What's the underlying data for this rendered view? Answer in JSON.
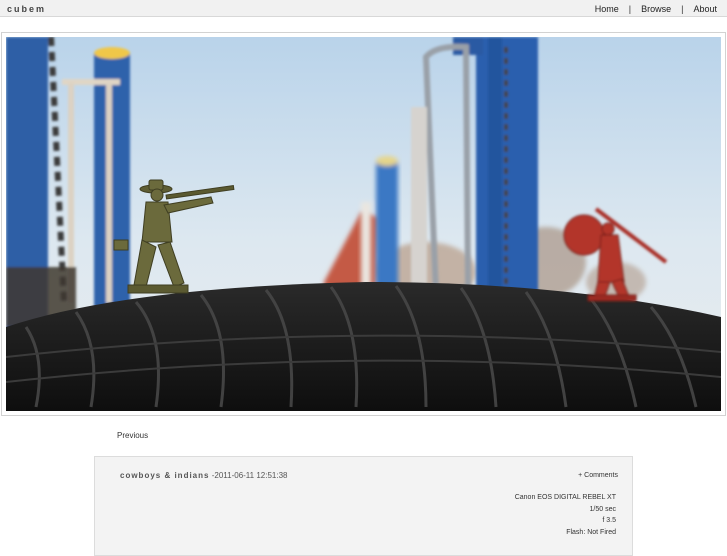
{
  "site": {
    "title": "cubem"
  },
  "nav": {
    "items": [
      {
        "label": "Home"
      },
      {
        "label": "Browse"
      },
      {
        "label": "About"
      }
    ],
    "separator": "|"
  },
  "photo": {
    "alt": "cowboys & indians"
  },
  "pagination": {
    "previous_label": "Previous"
  },
  "details": {
    "title": "cowboys & indians",
    "dash": "-",
    "date": "2011-06-11 12:51:38",
    "comments_label": "+ Comments",
    "exif": {
      "camera": "Canon EOS DIGITAL REBEL XT",
      "exposure": "1/50 sec",
      "aperture": "f 3.5",
      "flash": "Flash: Not Fired"
    }
  },
  "colors": {
    "topbar": "#f1f1f1",
    "panel": "#f3f3f3",
    "sky": "#cfe0ee",
    "pole_blue": "#2a5fa8",
    "tire": "#1c1c1c"
  }
}
